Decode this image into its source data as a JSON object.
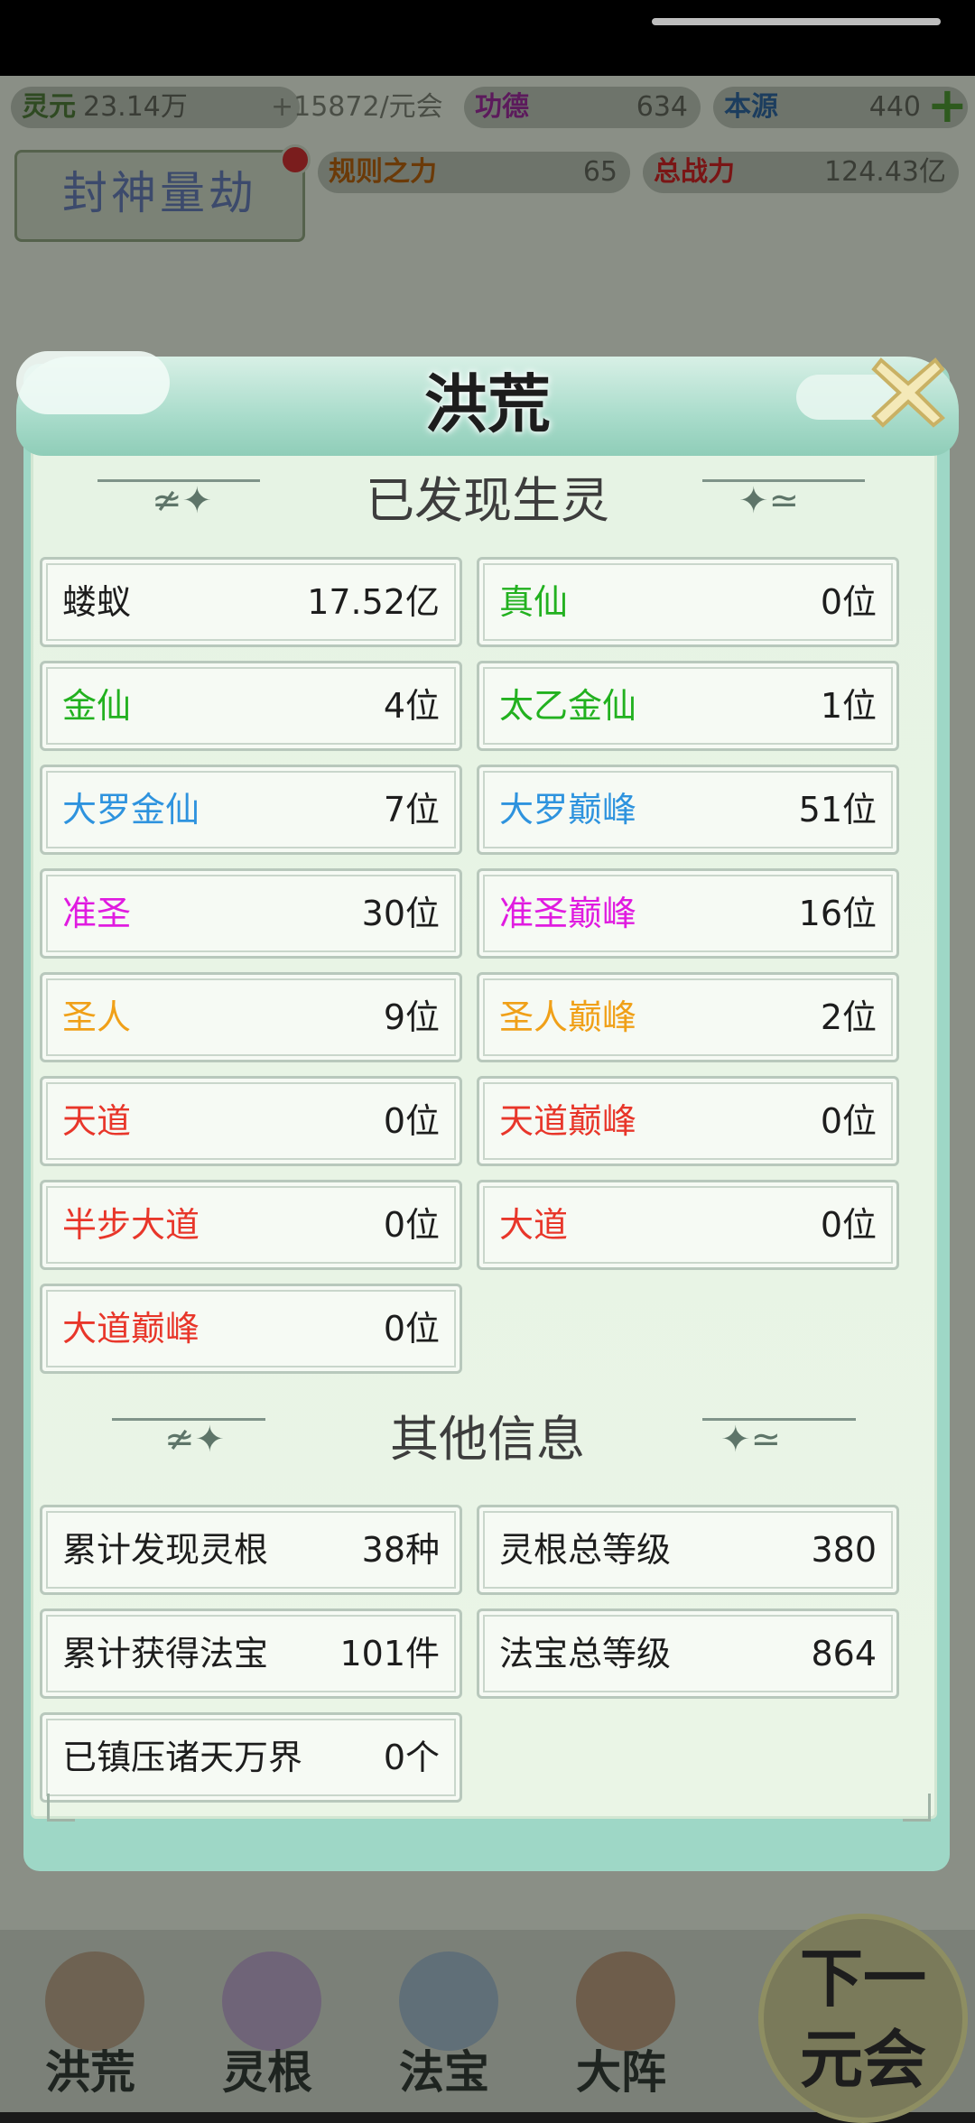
{
  "top_bar": {
    "lingyuan_label": "灵元",
    "lingyuan_value": "23.14万",
    "lingyuan_rate": "+15872/元会",
    "gongde_label": "功德",
    "gongde_value": "634",
    "benyuan_label": "本源",
    "benyuan_value": "440",
    "add_icon": "plus-icon"
  },
  "second_bar": {
    "fengshen_label": "封神量劫",
    "guize_label": "规则之力",
    "guize_value": "65",
    "zongzhanli_label": "总战力",
    "zongzhanli_value": "124.43亿"
  },
  "modal": {
    "title": "洪荒",
    "close_icon": "close-icon",
    "section1_title": "已发现生灵",
    "creatures": [
      {
        "label": "蝼蚁",
        "value": "17.52亿",
        "color": "#1d1d1d"
      },
      {
        "label": "真仙",
        "value": "0位",
        "color": "#22b11f"
      },
      {
        "label": "金仙",
        "value": "4位",
        "color": "#22b11f"
      },
      {
        "label": "太乙金仙",
        "value": "1位",
        "color": "#22b11f"
      },
      {
        "label": "大罗金仙",
        "value": "7位",
        "color": "#2e93de"
      },
      {
        "label": "大罗巅峰",
        "value": "51位",
        "color": "#2e93de"
      },
      {
        "label": "准圣",
        "value": "30位",
        "color": "#e01be0"
      },
      {
        "label": "准圣巅峰",
        "value": "16位",
        "color": "#e01be0"
      },
      {
        "label": "圣人",
        "value": "9位",
        "color": "#f0a018"
      },
      {
        "label": "圣人巅峰",
        "value": "2位",
        "color": "#f0a018"
      },
      {
        "label": "天道",
        "value": "0位",
        "color": "#e8362a"
      },
      {
        "label": "天道巅峰",
        "value": "0位",
        "color": "#e8362a"
      },
      {
        "label": "半步大道",
        "value": "0位",
        "color": "#e8362a"
      },
      {
        "label": "大道",
        "value": "0位",
        "color": "#e8362a"
      },
      {
        "label": "大道巅峰",
        "value": "0位",
        "color": "#e8362a"
      }
    ],
    "section2_title": "其他信息",
    "other_info": [
      {
        "label": "累计发现灵根",
        "value": "38种"
      },
      {
        "label": "灵根总等级",
        "value": "380"
      },
      {
        "label": "累计获得法宝",
        "value": "101件"
      },
      {
        "label": "法宝总等级",
        "value": "864"
      },
      {
        "label": "已镇压诸天万界",
        "value": "0个"
      }
    ]
  },
  "bottom_nav": [
    {
      "label": "洪荒",
      "icon": "mountain-icon"
    },
    {
      "label": "灵根",
      "icon": "lotus-icon"
    },
    {
      "label": "法宝",
      "icon": "treasure-icon"
    },
    {
      "label": "大阵",
      "icon": "taiji-icon"
    }
  ],
  "next_button": {
    "line1": "下一",
    "line2": "元会"
  }
}
